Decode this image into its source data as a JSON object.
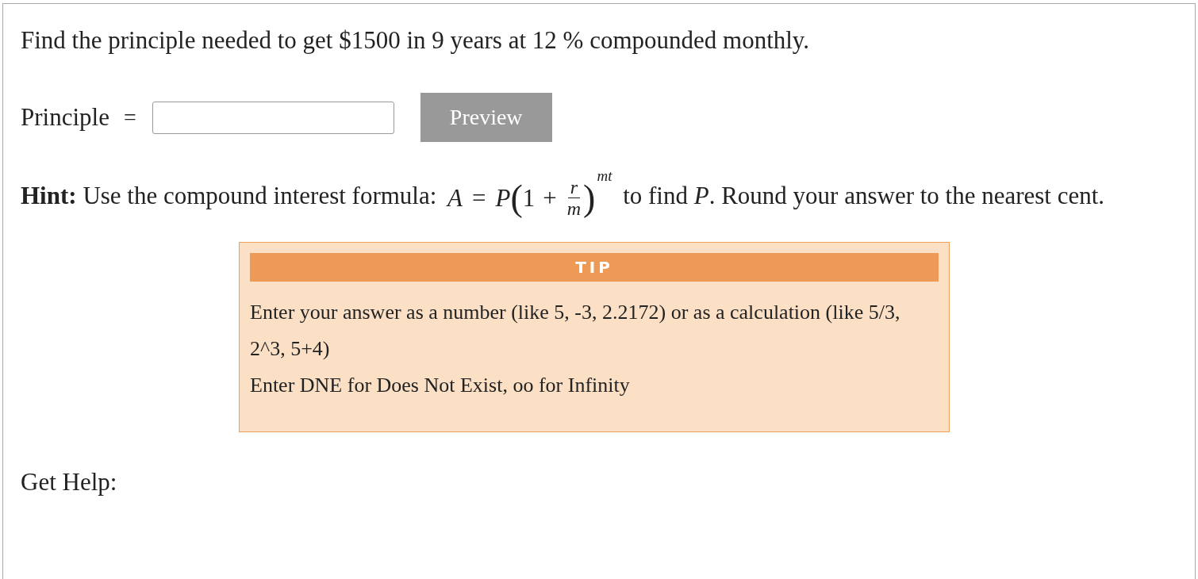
{
  "question": "Find the principle needed to get $1500 in 9 years at 12 % compounded monthly.",
  "answer": {
    "label": "Principle",
    "equals": "=",
    "button": "Preview"
  },
  "hint": {
    "before": "**Hint:** Use the compound interest formula:",
    "formula": {
      "lhs": "A",
      "equals": "=",
      "factor": "P",
      "open": "(",
      "one": "1",
      "plus": "+",
      "numerator": "r",
      "denominator": "m",
      "close": ")",
      "exponent": "mt"
    },
    "after": "to find *P*. Round your answer to the nearest cent."
  },
  "tip": {
    "title": "TIP",
    "lines": [
      "Enter your answer as a number (like 5, -3, 2.2172) or as a calculation (like 5/3, 2^3, 5+4)",
      "Enter DNE for Does Not Exist, oo for Infinity"
    ]
  },
  "help": "Get Help:"
}
